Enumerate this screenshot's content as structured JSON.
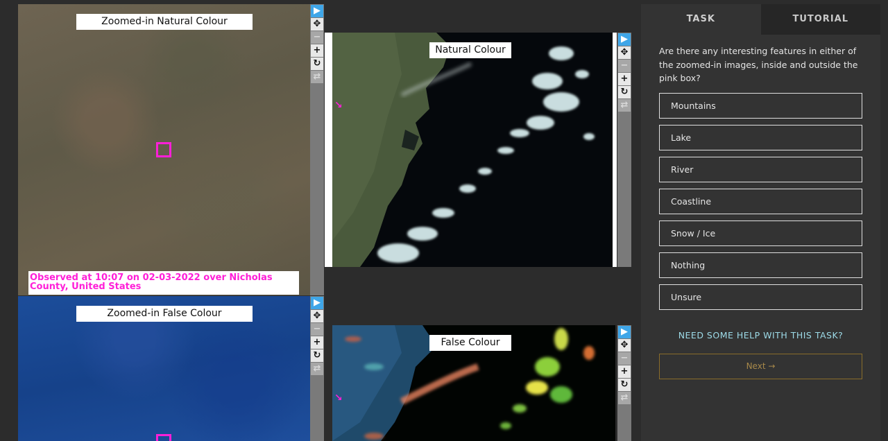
{
  "panels": {
    "zoomed_natural": {
      "label": "Zoomed-in Natural Colour"
    },
    "zoomed_false": {
      "label": "Zoomed-in False Colour"
    },
    "natural": {
      "label": "Natural Colour"
    },
    "false": {
      "label": "False Colour"
    }
  },
  "observed_text": "Observed at 10:07 on 02-03-2022 over Nicholas County, United States",
  "toolbar_icons": [
    "pointer-icon",
    "move-icon",
    "zoom-out-icon",
    "zoom-in-icon",
    "rotate-icon",
    "reset-icon"
  ],
  "tabs": [
    {
      "label": "TASK",
      "active": true
    },
    {
      "label": "TUTORIAL",
      "active": false
    }
  ],
  "task": {
    "question": "Are there any interesting features in either of the zoomed-in images, inside and outside the pink box?",
    "answers": [
      "Mountains",
      "Lake",
      "River",
      "Coastline",
      "Snow / Ice",
      "Nothing",
      "Unsure"
    ],
    "help_label": "NEED SOME HELP WITH THIS TASK?",
    "next_label": "Next →"
  },
  "colors": {
    "accent_pink": "#ff1fd8",
    "tool_active": "#3fa6e8",
    "help_link": "#9ddbe8",
    "next_border": "#8a6d2a"
  }
}
